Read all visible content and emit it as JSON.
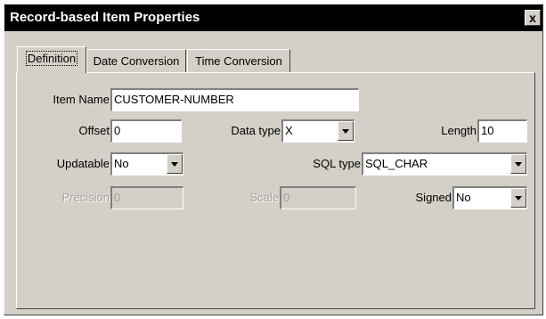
{
  "window": {
    "title": "Record-based Item Properties",
    "close_glyph": "x"
  },
  "tabs": [
    {
      "label": "Definition",
      "active": true
    },
    {
      "label": "Date Conversion",
      "active": false
    },
    {
      "label": "Time Conversion",
      "active": false
    }
  ],
  "form": {
    "item_name": {
      "label": "Item Name",
      "value": "CUSTOMER-NUMBER"
    },
    "offset": {
      "label": "Offset",
      "value": "0"
    },
    "data_type": {
      "label": "Data type",
      "value": "X"
    },
    "length": {
      "label": "Length",
      "value": "10"
    },
    "updatable": {
      "label": "Updatable",
      "value": "No"
    },
    "sql_type": {
      "label": "SQL type",
      "value": "SQL_CHAR"
    },
    "precision": {
      "label": "Precision",
      "value": "0",
      "enabled": false
    },
    "scale": {
      "label": "Scale",
      "value": "0",
      "enabled": false
    },
    "signed": {
      "label": "Signed",
      "value": "No"
    }
  }
}
